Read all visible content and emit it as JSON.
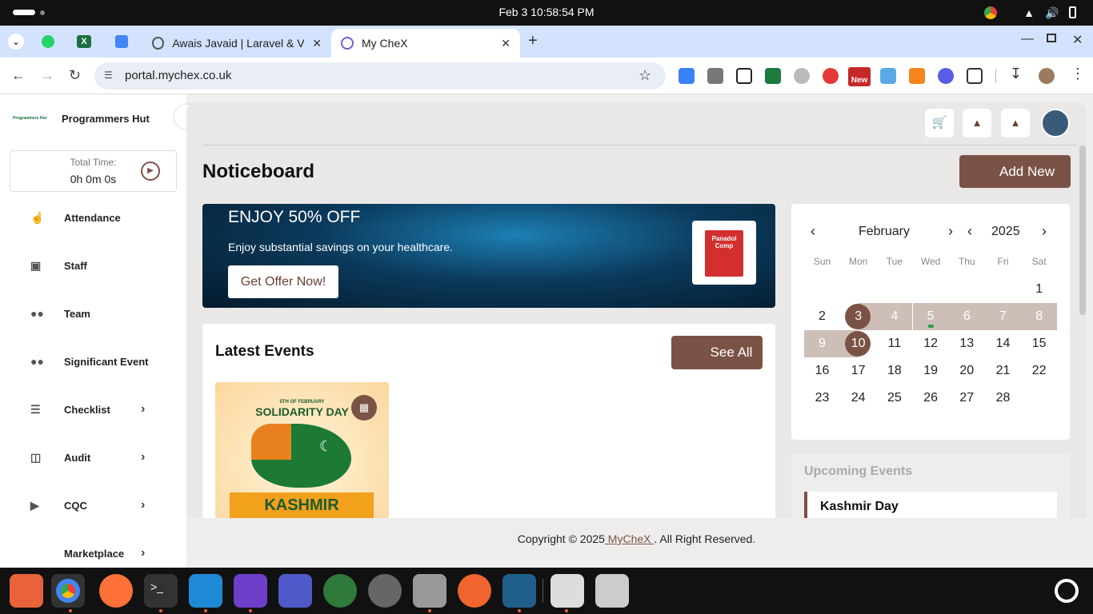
{
  "system": {
    "clock": "Feb 3  10:58:54 PM"
  },
  "browser": {
    "tabs": [
      {
        "label": "Awais Javaid | Laravel & V",
        "active": false
      },
      {
        "label": "My CheX",
        "active": true
      }
    ],
    "url": "portal.mychex.co.uk",
    "ext_new_badge": "New"
  },
  "sidebar": {
    "org_name": "Programmers Hut",
    "org_logo_text": "Programmers Hut",
    "timer_label": "Total Time:",
    "timer_value": "0h 0m 0s",
    "items": [
      {
        "label": "Attendance",
        "icon": "hand-pointer-icon",
        "chevron": false
      },
      {
        "label": "Staff",
        "icon": "id-badge-icon",
        "chevron": false
      },
      {
        "label": "Team",
        "icon": "users-icon",
        "chevron": false
      },
      {
        "label": "Significant Event",
        "icon": "users-icon",
        "chevron": false
      },
      {
        "label": "Checklist",
        "icon": "list-icon",
        "chevron": true
      },
      {
        "label": "Audit",
        "icon": "search-doc-icon",
        "chevron": true
      },
      {
        "label": "CQC",
        "icon": "megaphone-icon",
        "chevron": true
      },
      {
        "label": "Marketplace",
        "icon": "store-icon",
        "chevron": true
      }
    ]
  },
  "header": {
    "title": "Noticeboard",
    "add_new_label": "Add New"
  },
  "banner": {
    "headline": "ENJOY 50% OFF",
    "subtext": "Enjoy substantial savings on your healthcare.",
    "cta": "Get Offer Now!",
    "product_text": "Panadol Comp"
  },
  "events": {
    "title": "Latest Events",
    "see_all": "See All",
    "card": {
      "top_text": "5TH OF FEBRUARY",
      "title": "SOLIDARITY DAY",
      "ribbon": "KASHMIR"
    }
  },
  "calendar": {
    "month": "February",
    "year": "2025",
    "weekdays": [
      "Sun",
      "Mon",
      "Tue",
      "Wed",
      "Thu",
      "Fri",
      "Sat"
    ],
    "weeks": [
      [
        "",
        "",
        "",
        "",
        "",
        "",
        "1"
      ],
      [
        "2",
        "3",
        "4",
        "5",
        "6",
        "7",
        "8"
      ],
      [
        "9",
        "10",
        "11",
        "12",
        "13",
        "14",
        "15"
      ],
      [
        "16",
        "17",
        "18",
        "19",
        "20",
        "21",
        "22"
      ],
      [
        "23",
        "24",
        "25",
        "26",
        "27",
        "28",
        ""
      ]
    ],
    "selected_days": [
      "3",
      "10"
    ],
    "range_days": [
      "4",
      "5",
      "6",
      "7",
      "8",
      "9"
    ],
    "event_dot_day": "5"
  },
  "upcoming": {
    "title": "Upcoming Events",
    "first": "Kashmir Day"
  },
  "footer": {
    "prefix": "Copyright © 2025",
    "brand": " MyCheX ",
    "suffix": ". All Right Reserved."
  },
  "colors": {
    "brand": "#7b5346",
    "range": "#cdbfb8"
  }
}
